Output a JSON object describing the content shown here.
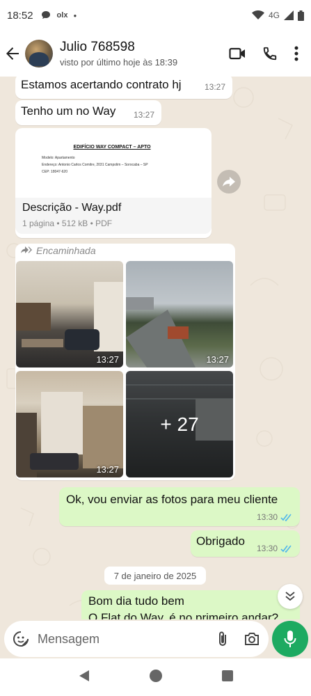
{
  "status_bar": {
    "time": "18:52",
    "icons": [
      "chat-bubble-icon",
      "olx-icon",
      "dot-icon"
    ],
    "olx": "olx",
    "network": "4G"
  },
  "header": {
    "contact_name": "Julio 768598",
    "last_seen": "visto por último hoje às 18:39",
    "icons": [
      "back-arrow-icon",
      "video-call-icon",
      "phone-icon",
      "more-options-icon"
    ]
  },
  "messages": {
    "m1": {
      "text": "Estamos acertando contrato hj",
      "time": "13:27"
    },
    "m2": {
      "text": "Tenho um no Way",
      "time": "13:27"
    },
    "doc": {
      "preview_title": "EDIFÍCIO WAY COMPACT – APTO",
      "preview_lines": [
        "Modelo: Apartamento",
        "Endereço: Antonio Carlos Comitre, 2031 Campolim – Sorocaba – SP",
        "CEP: 18047-620"
      ],
      "file_name": "Descrição - Way.pdf",
      "meta": "1 página • 512 kB • PDF"
    },
    "album": {
      "forwarded_label": "Encaminhada",
      "photos": [
        {
          "time": "13:27",
          "desc": "living-room-photo"
        },
        {
          "time": "13:27",
          "desc": "city-view-photo"
        },
        {
          "time": "13:27",
          "desc": "living-room-curtains-photo"
        },
        {
          "more": "+ 27",
          "desc": "garage-photo"
        }
      ]
    },
    "m3": {
      "text": "Ok, vou enviar as fotos para meu cliente",
      "time": "13:30"
    },
    "m4": {
      "text": "Obrigado",
      "time": "13:30"
    },
    "date_separator": "7 de janeiro de 2025",
    "m5": {
      "line1": "Bom dia tudo bem",
      "line2": "O Flat do Way, é no primeiro andar?"
    }
  },
  "composer": {
    "placeholder": "Mensagem",
    "icons": [
      "sticker-icon",
      "attach-icon",
      "camera-icon",
      "mic-icon"
    ]
  },
  "navbar": {
    "icons": [
      "nav-back-icon",
      "nav-home-icon",
      "nav-recents-icon"
    ]
  },
  "colors": {
    "outgoing": "#dcf8c6",
    "incoming": "#ffffff",
    "chat_bg": "#efe7dc",
    "read_ticks": "#4fb6ec",
    "mic_button": "#1daa61"
  }
}
